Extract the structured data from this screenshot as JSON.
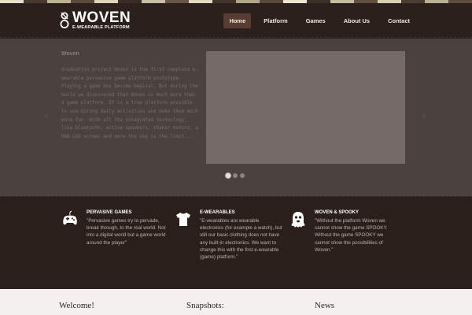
{
  "colors": {
    "strip": [
      "#e8e0c8",
      "#4a3a30",
      "#bcb38f",
      "#5c4a3c",
      "#ddd5b5",
      "#3a2c24",
      "#c8c0a0",
      "#6a5646",
      "#e2dac2",
      "#443428",
      "#b0a888",
      "#5a4838",
      "#ede5cd",
      "#3e3028",
      "#c6be9e",
      "#645040",
      "#d8d0b0",
      "#4c3c30",
      "#bab294",
      "#5e4c3e"
    ]
  },
  "header": {
    "logo_title": "WOVEN",
    "logo_subtitle": "E-WEARABLE PLATFORM",
    "nav": [
      {
        "label": "Home",
        "active": true
      },
      {
        "label": "Platform",
        "active": false
      },
      {
        "label": "Games",
        "active": false
      },
      {
        "label": "About Us",
        "active": false
      },
      {
        "label": "Contact",
        "active": false
      }
    ]
  },
  "hero": {
    "title": "Woven",
    "body": "Graduation project Woven is the first complete e-wearable pervasive game platform prototype. Playing a game has become magical. But during the build we discovered that Woven is much more than a game platform. It is a true platform possible to use during daily activities and make them much more fun. With all the integrated technology, like bluetooth, active speakers, shaker motors, a RGB LED screen and more the sky is the limit...",
    "arrow_left": "‹",
    "arrow_right": "›",
    "slides": 3,
    "active_slide": 1
  },
  "features": [
    {
      "icon": "gamepad-icon",
      "title": "PERVASIVE GAMES",
      "body": "\"Pervasive games try to pervade, break through, to the real world. Not into a digital world but a game world around the player\""
    },
    {
      "icon": "tshirt-icon",
      "title": "E-WEARABLES",
      "body": "\"E-wearables are wearable electronics (for example a watch), but still our basic clothing does not have any built-in electronics. We want to change this with the first e-wearable (game) platform.\""
    },
    {
      "icon": "ghost-icon",
      "title": "WOVEN & SPOOKY",
      "body": "\"Without the platform Woven we cannot show the game SPOOKY. Without the game SPOOKY we cannot show the possibilities of Woven.\""
    }
  ],
  "bottom": {
    "welcome": "Welcome!",
    "snapshots": "Snapshots:",
    "news": "News"
  }
}
